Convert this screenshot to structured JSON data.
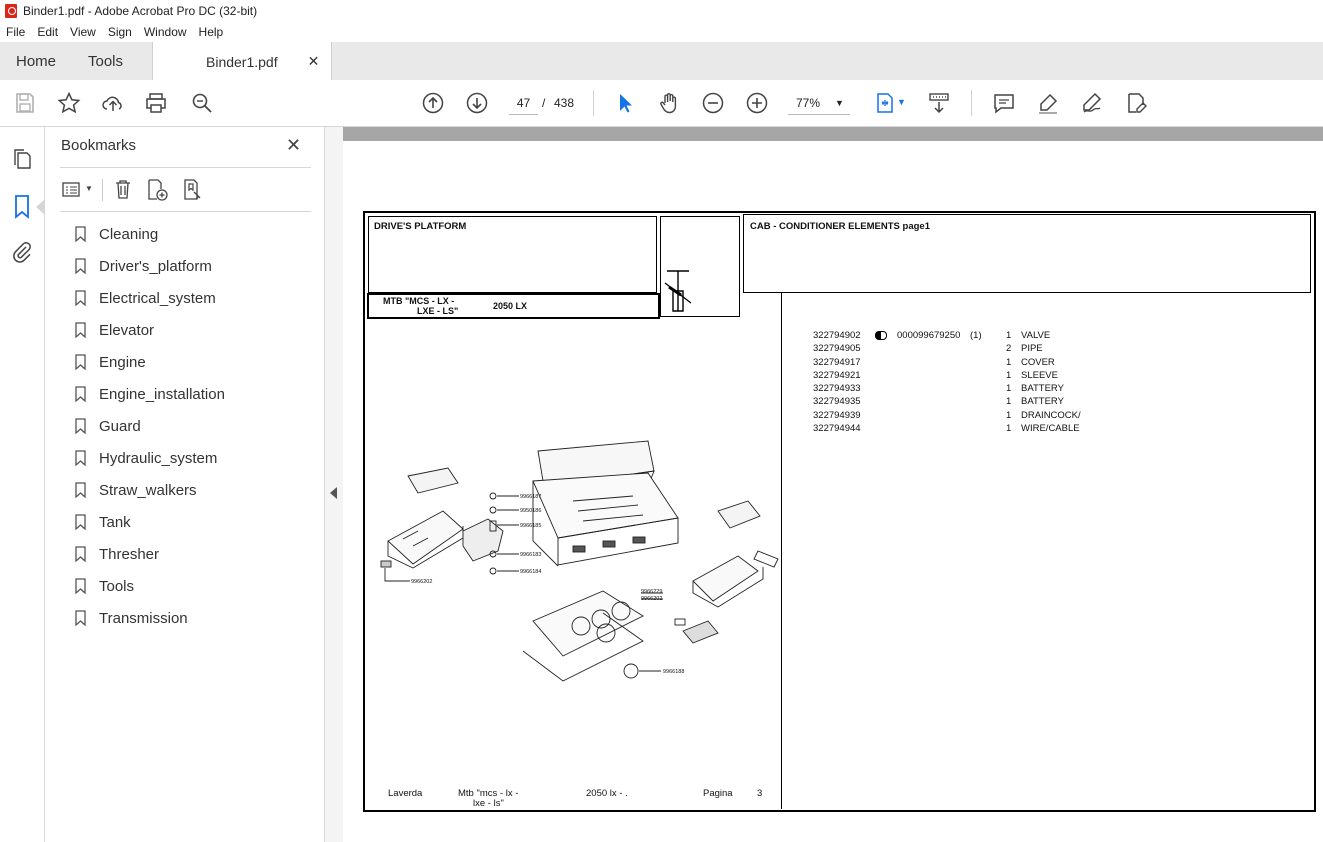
{
  "window": {
    "title": "Binder1.pdf - Adobe Acrobat Pro DC (32-bit)"
  },
  "menu": [
    "File",
    "Edit",
    "View",
    "Sign",
    "Window",
    "Help"
  ],
  "tabs": {
    "home": "Home",
    "tools": "Tools",
    "document": "Binder1.pdf"
  },
  "toolbar": {
    "page_current": "47",
    "page_separator": "/",
    "page_total": "438",
    "zoom": "77%"
  },
  "bookmarks": {
    "title": "Bookmarks",
    "items": [
      "Cleaning",
      "Driver's_platform",
      "Electrical_system",
      "Elevator",
      "Engine",
      "Engine_installation",
      "Guard",
      "Hydraulic_system",
      "Straw_walkers",
      "Tank",
      "Thresher",
      "Tools",
      "Transmission"
    ]
  },
  "document": {
    "section_title": "DRIVE'S PLATFORM",
    "model_line1": "MTB \"MCS - LX -",
    "model_line2": "LXE - LS\"",
    "model_code": "2050 LX",
    "part_title": "CAB - CONDITIONER ELEMENTS  page1",
    "parts": [
      {
        "code": "322794902",
        "ref": "000099679250",
        "note": "(1)",
        "qty": "1",
        "desc": "VALVE"
      },
      {
        "code": "322794905",
        "ref": "",
        "note": "",
        "qty": "2",
        "desc": "PIPE"
      },
      {
        "code": "322794917",
        "ref": "",
        "note": "",
        "qty": "1",
        "desc": "COVER"
      },
      {
        "code": "322794921",
        "ref": "",
        "note": "",
        "qty": "1",
        "desc": "SLEEVE"
      },
      {
        "code": "322794933",
        "ref": "",
        "note": "",
        "qty": "1",
        "desc": "BATTERY"
      },
      {
        "code": "322794935",
        "ref": "",
        "note": "",
        "qty": "1",
        "desc": "BATTERY"
      },
      {
        "code": "322794939",
        "ref": "",
        "note": "",
        "qty": "1",
        "desc": "DRAINCOCK/"
      },
      {
        "code": "322794944",
        "ref": "",
        "note": "",
        "qty": "1",
        "desc": "WIRE/CABLE"
      }
    ],
    "callouts": [
      "9966187",
      "9950186",
      "9966185",
      "9966183",
      "9966184",
      "9966202",
      "9966229",
      "9966202",
      "9966188"
    ],
    "footer": {
      "brand": "Laverda",
      "model_a": "Mtb \"mcs - lx -",
      "model_b": "lxe - ls\"",
      "code": "2050 lx - .",
      "page_label": "Pagina",
      "page_num": "3"
    }
  },
  "colors": {
    "accent": "#1473e6",
    "pdf_red": "#d8281c"
  }
}
